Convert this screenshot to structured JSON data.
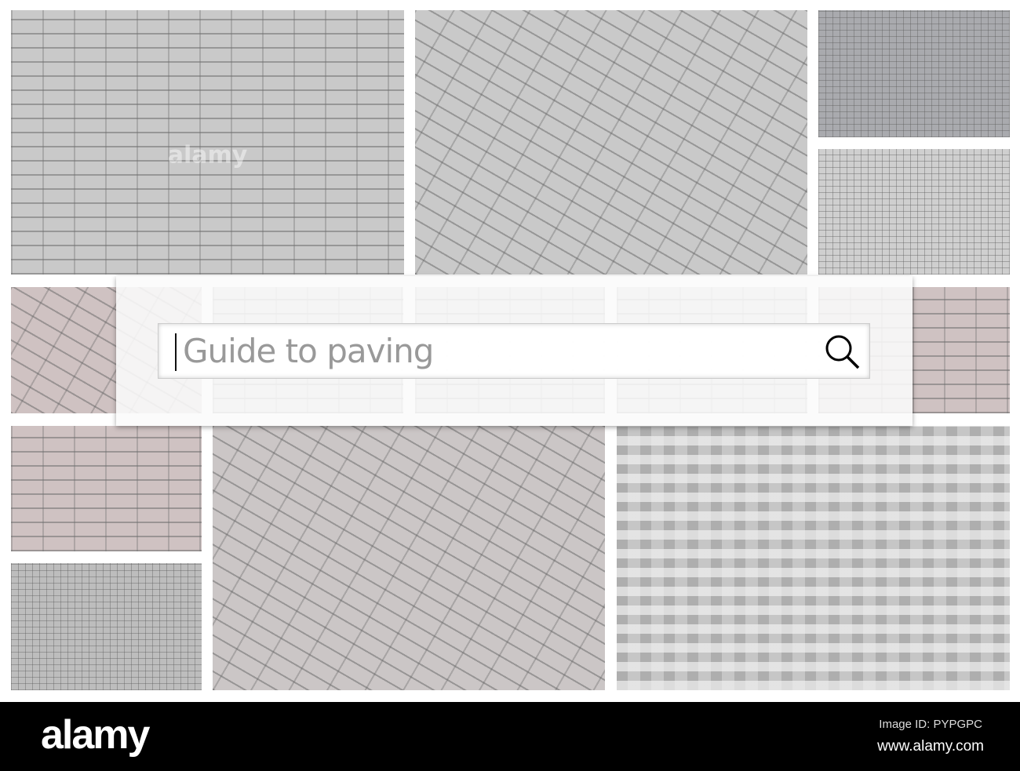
{
  "search": {
    "query": "Guide to paving",
    "icon": "search-icon"
  },
  "watermark": "alamy",
  "footer": {
    "logo": "alamy",
    "image_id": "Image ID: PYPGPC",
    "url": "www.alamy.com"
  }
}
